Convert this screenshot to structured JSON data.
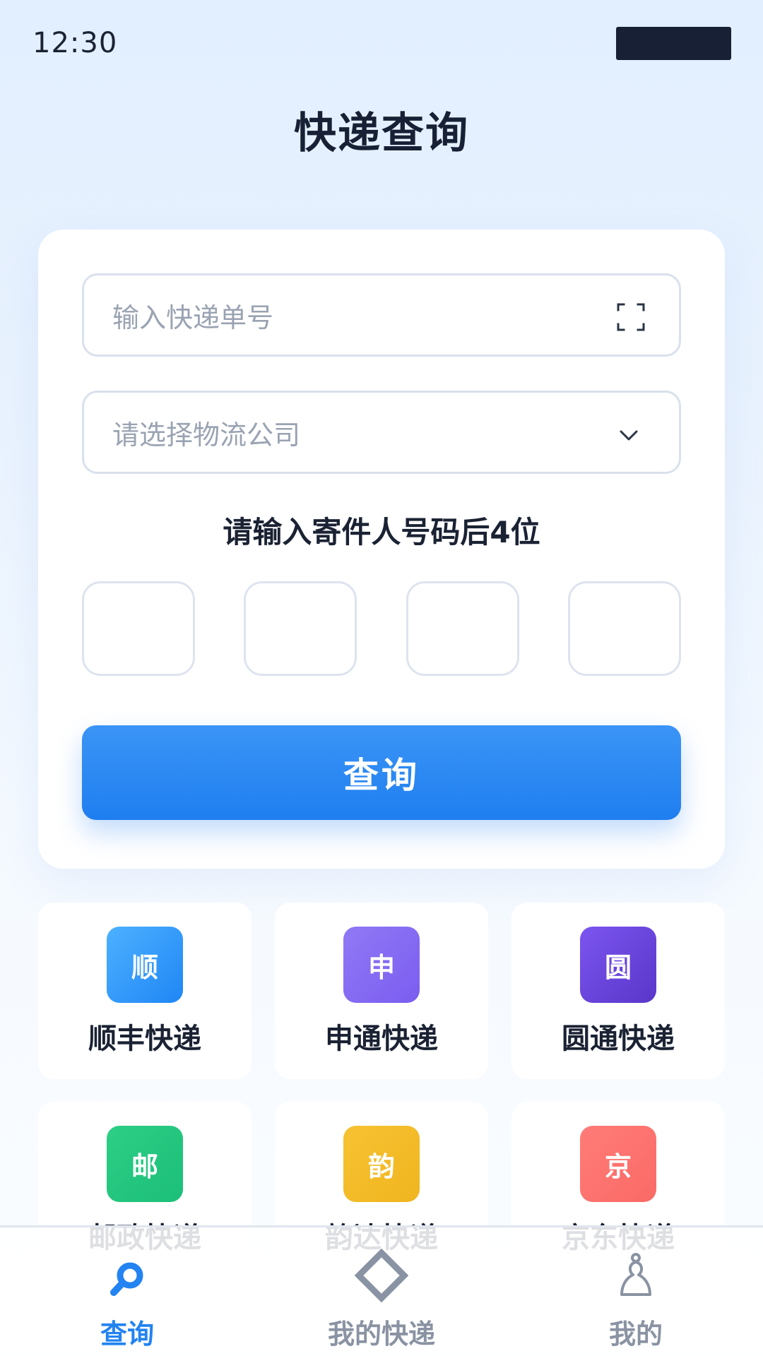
{
  "status_bar": {
    "time": "12:30"
  },
  "page": {
    "title": "快递查询"
  },
  "form": {
    "tracking_placeholder": "输入快递单号",
    "company_placeholder": "请选择物流公司",
    "phone_label": "请输入寄件人号码后4位",
    "digits": [
      "",
      "",
      "",
      ""
    ],
    "submit_label": "查询"
  },
  "couriers": [
    {
      "badge": "顺",
      "name": "顺丰快递",
      "color_from": "#4db1ff",
      "color_to": "#1f86f5"
    },
    {
      "badge": "申",
      "name": "申通快递",
      "color_from": "#9079f5",
      "color_to": "#7b5df0"
    },
    {
      "badge": "圆",
      "name": "圆通快递",
      "color_from": "#7b55ef",
      "color_to": "#5a36c9"
    },
    {
      "badge": "邮",
      "name": "邮政快递",
      "color_from": "#2dce86",
      "color_to": "#1cbf78"
    },
    {
      "badge": "韵",
      "name": "韵达快递",
      "color_from": "#f7c232",
      "color_to": "#f0b51f"
    },
    {
      "badge": "京",
      "name": "京东快递",
      "color_from": "#ff7c78",
      "color_to": "#fa6a66"
    }
  ],
  "bottom_nav": {
    "items": [
      {
        "label": "查询",
        "icon": "search-icon",
        "active": true
      },
      {
        "label": "我的快递",
        "icon": "package-diamond-icon",
        "active": false
      },
      {
        "label": "我的",
        "icon": "user-icon",
        "active": false
      }
    ]
  },
  "colors": {
    "accent": "#2383f1",
    "title": "#172034",
    "placeholder": "#9aa3b2",
    "inactive_nav": "#8a93a3"
  }
}
